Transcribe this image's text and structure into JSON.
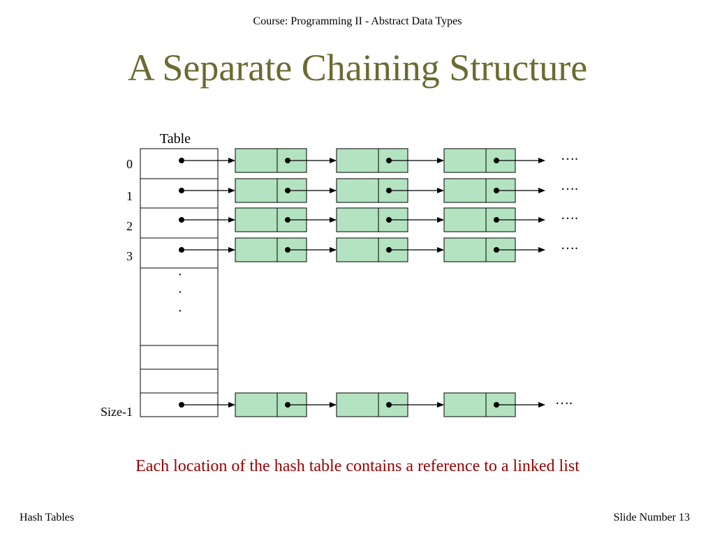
{
  "header": {
    "course": "Course: Programming II - Abstract Data Types"
  },
  "slide": {
    "title": "A Separate Chaining Structure"
  },
  "diagram": {
    "table_label": "Table",
    "index_labels": [
      "0",
      "1",
      "2",
      "3",
      "Size-1"
    ],
    "vertical_dots": [
      "·",
      "·",
      "·"
    ],
    "continuation": "….",
    "node_fill": "#b3e3c0",
    "chains_per_row": 3
  },
  "caption": "Each location of the hash table contains a reference to a linked list",
  "footer": {
    "left": "Hash Tables",
    "right": "Slide Number 13"
  },
  "colors": {
    "title": "#6b6b32",
    "caption": "#990000"
  }
}
